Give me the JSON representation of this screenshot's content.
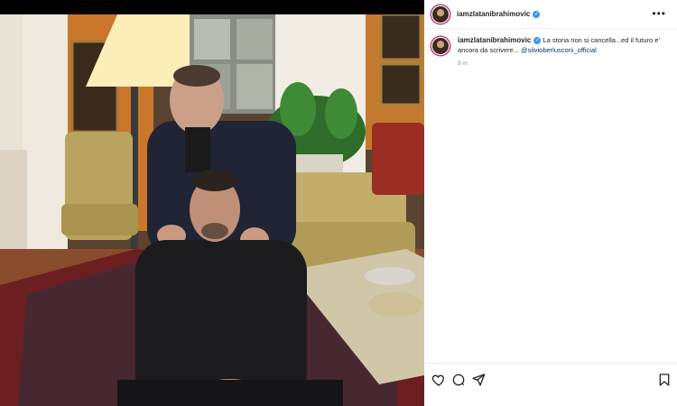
{
  "post": {
    "username": "iamzlatanibrahimovic",
    "caption_text": "La storia non si cancella...ed il futuro e' ancora da scrivere...",
    "mention": "@silvioberlusconi_official",
    "time_ago": "9 m",
    "more_icon": "more-horizontal-icon"
  },
  "actions": {
    "like_icon": "heart-icon",
    "comment_icon": "comment-icon",
    "share_icon": "send-icon",
    "save_icon": "bookmark-icon"
  },
  "colors": {
    "mention": "#00376b",
    "verified": "#3897f0",
    "muted": "#8e8e8e"
  }
}
